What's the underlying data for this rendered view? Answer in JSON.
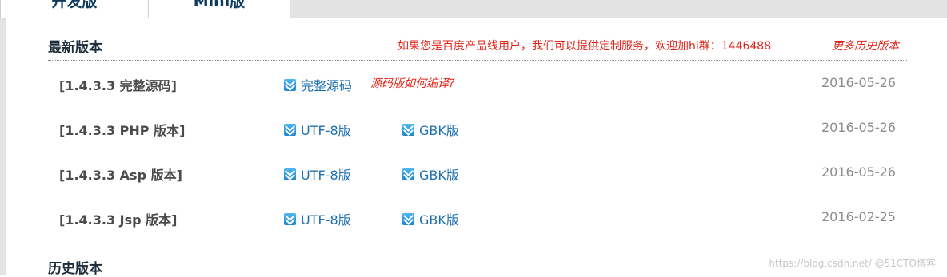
{
  "tabs": [
    {
      "label": "开发版",
      "active": true
    },
    {
      "label": "Mini版",
      "active": false
    }
  ],
  "latest": {
    "title": "最新版本",
    "promo": "如果您是百度产品线用户，我们可以提供定制服务，欢迎加hi群：1446488",
    "more": "更多历史版本"
  },
  "rows": [
    {
      "name": "[1.4.3.3 完整源码]",
      "links": [
        "完整源码"
      ],
      "hint": "源码版如何编译?",
      "date": "2016-05-26"
    },
    {
      "name": "[1.4.3.3 PHP 版本]",
      "links": [
        "UTF-8版",
        "GBK版"
      ],
      "date": "2016-05-26"
    },
    {
      "name": "[1.4.3.3 Asp 版本]",
      "links": [
        "UTF-8版",
        "GBK版"
      ],
      "date": "2016-05-26"
    },
    {
      "name": "[1.4.3.3 Jsp 版本]",
      "links": [
        "UTF-8版",
        "GBK版"
      ],
      "date": "2016-02-25"
    }
  ],
  "history": {
    "title": "历史版本"
  },
  "watermark": "https://blog.csdn.net/ @51CTO博客",
  "colors": {
    "link": "#1f6fae",
    "accent": "#e1251b",
    "date": "#8c8c8c"
  },
  "icons": {
    "download": "download-icon"
  }
}
